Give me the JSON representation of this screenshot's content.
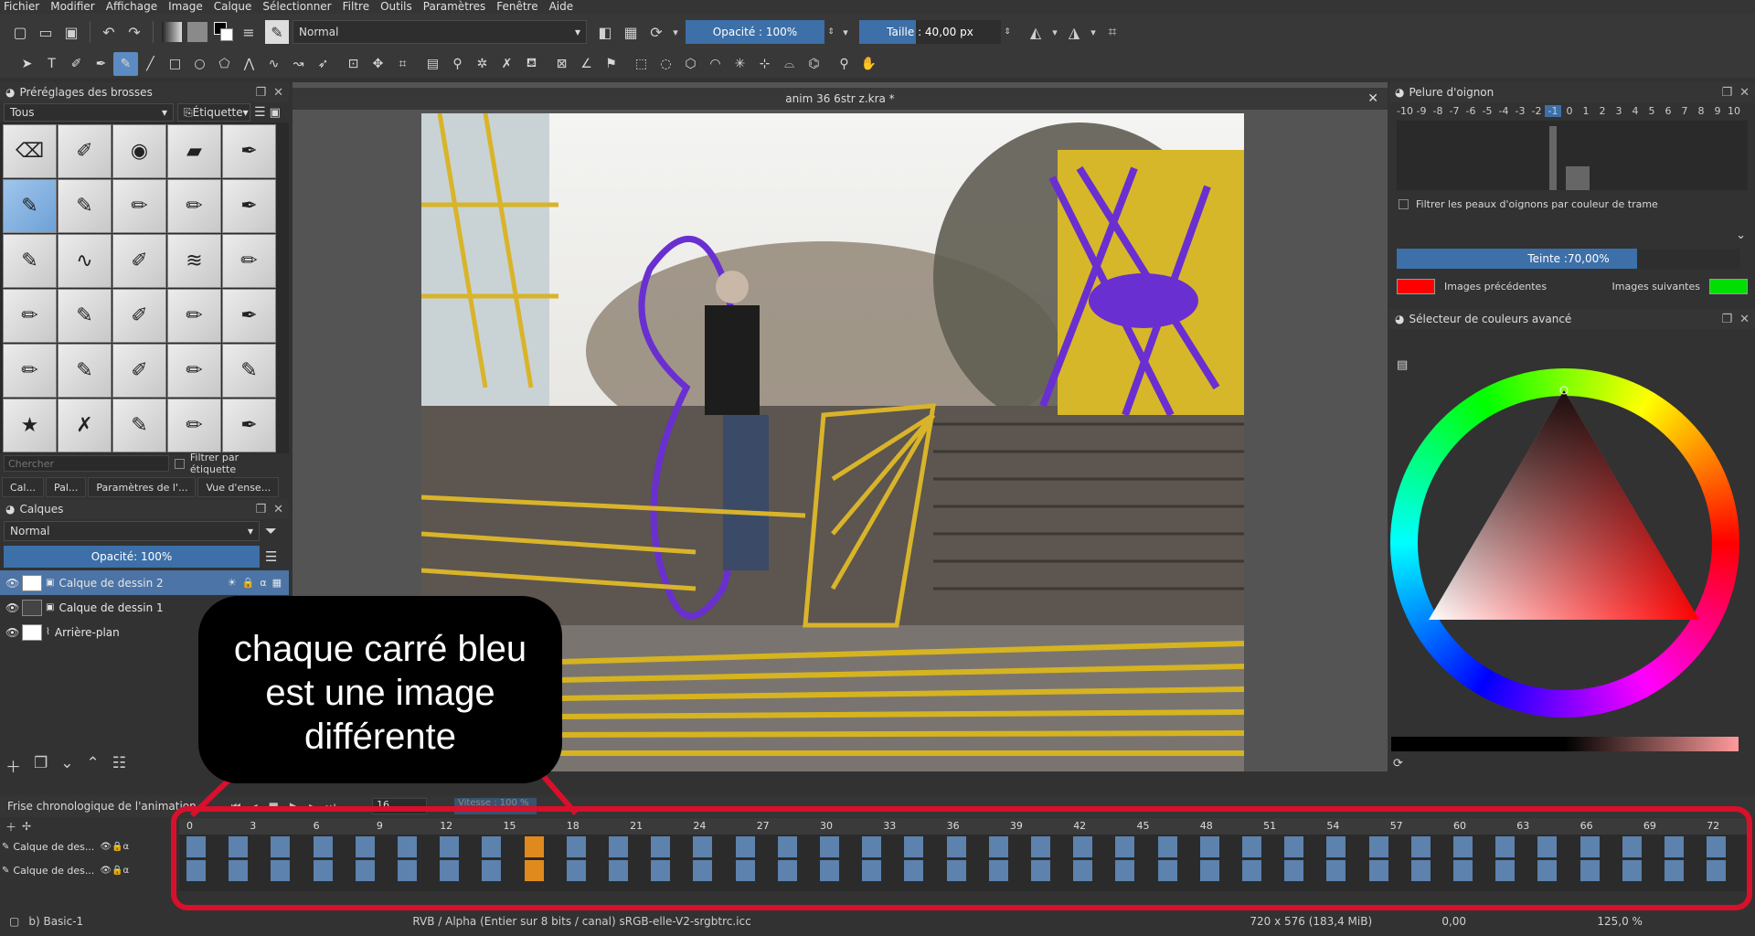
{
  "menu": [
    "Fichier",
    "Modifier",
    "Affichage",
    "Image",
    "Calque",
    "Sélectionner",
    "Filtre",
    "Outils",
    "Paramètres",
    "Fenêtre",
    "Aide"
  ],
  "toolbar": {
    "blend_mode": "Normal",
    "opacity": "Opacité : 100%",
    "size": "Taille : 40,00 px"
  },
  "brush_panel": {
    "title": "Préréglages des brosses",
    "filter_combo": "Tous",
    "tag_button": "Étiquette",
    "search_placeholder": "Chercher",
    "filter_by_tag": "Filtrer par étiquette",
    "tabs": [
      "Cal...",
      "Pal...",
      "Paramètres de l'...",
      "Vue d'ense..."
    ]
  },
  "layers_panel": {
    "title": "Calques",
    "blend_mode": "Normal",
    "opacity": "Opacité:  100%",
    "layers": [
      {
        "name": "Calque de dessin 2",
        "selected": true
      },
      {
        "name": "Calque de dessin 1",
        "selected": false
      },
      {
        "name": "Arrière-plan",
        "selected": false
      }
    ]
  },
  "document": {
    "title": "anim 36 6str z.kra *"
  },
  "onion_panel": {
    "title": "Pelure d'oignon",
    "scale": [
      "-10",
      "-9",
      "-8",
      "-7",
      "-6",
      "-5",
      "-4",
      "-3",
      "-2",
      "-1",
      "0",
      "1",
      "2",
      "3",
      "4",
      "5",
      "6",
      "7",
      "8",
      "9",
      "10"
    ],
    "filter_label": "Filtrer les peaux d'oignons par couleur de trame",
    "tint": "Teinte :70,00%",
    "tint_level": 0.7,
    "previous_label": "Images précédentes",
    "next_label": "Images suivantes",
    "previous_color": "#ff0000",
    "next_color": "#00dd00"
  },
  "color_panel": {
    "title": "Sélecteur de couleurs avancé"
  },
  "timeline": {
    "title": "Frise chronologique de l'animation",
    "frame_field": "16",
    "speed_field": "Vitesse : 100 %",
    "rows": [
      "Calque de des...",
      "Calque de des..."
    ],
    "ruler": [
      "0",
      "3",
      "6",
      "9",
      "12",
      "15",
      "18",
      "21",
      "24",
      "27",
      "30",
      "33",
      "36",
      "39",
      "42",
      "45",
      "48",
      "51",
      "54",
      "57",
      "60",
      "63",
      "66",
      "69",
      "72"
    ],
    "current_frame": 16
  },
  "status": {
    "brush": "b) Basic-1",
    "color_space": "RVB / Alpha (Entier sur 8 bits / canal) sRGB-elle-V2-srgbtrc.icc",
    "image_size": "720 x 576 (183,4 MiB)",
    "rotation": "0,00",
    "zoom": "125,0 %"
  },
  "annotation": {
    "line1": "chaque carré bleu",
    "line2": "est une image",
    "line3": "différente"
  }
}
